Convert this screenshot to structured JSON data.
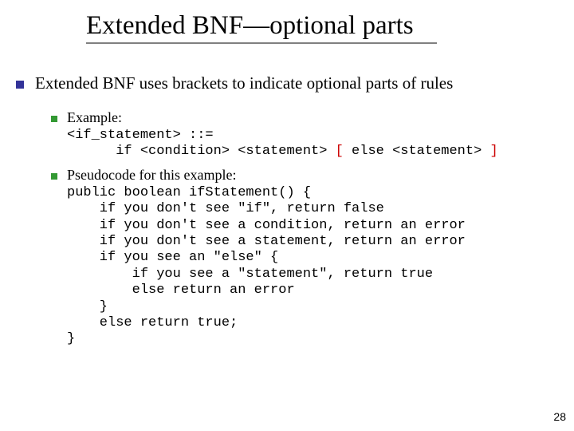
{
  "title": "Extended BNF—optional parts",
  "bullet_main": "Extended BNF uses brackets to indicate optional parts of rules",
  "example_label": "Example:",
  "code1_line1": "<if_statement> ::=",
  "code1_line2a": "      if <condition> <statement> ",
  "code1_open": "[",
  "code1_mid": " else <statement> ",
  "code1_close": "]",
  "pseudo_label": "Pseudocode for this example:",
  "code2": "public boolean ifStatement() {\n    if you don't see \"if\", return false\n    if you don't see a condition, return an error\n    if you don't see a statement, return an error\n    if you see an \"else\" {\n        if you see a \"statement\", return true\n        else return an error\n    }\n    else return true;\n}",
  "page_number": "28"
}
